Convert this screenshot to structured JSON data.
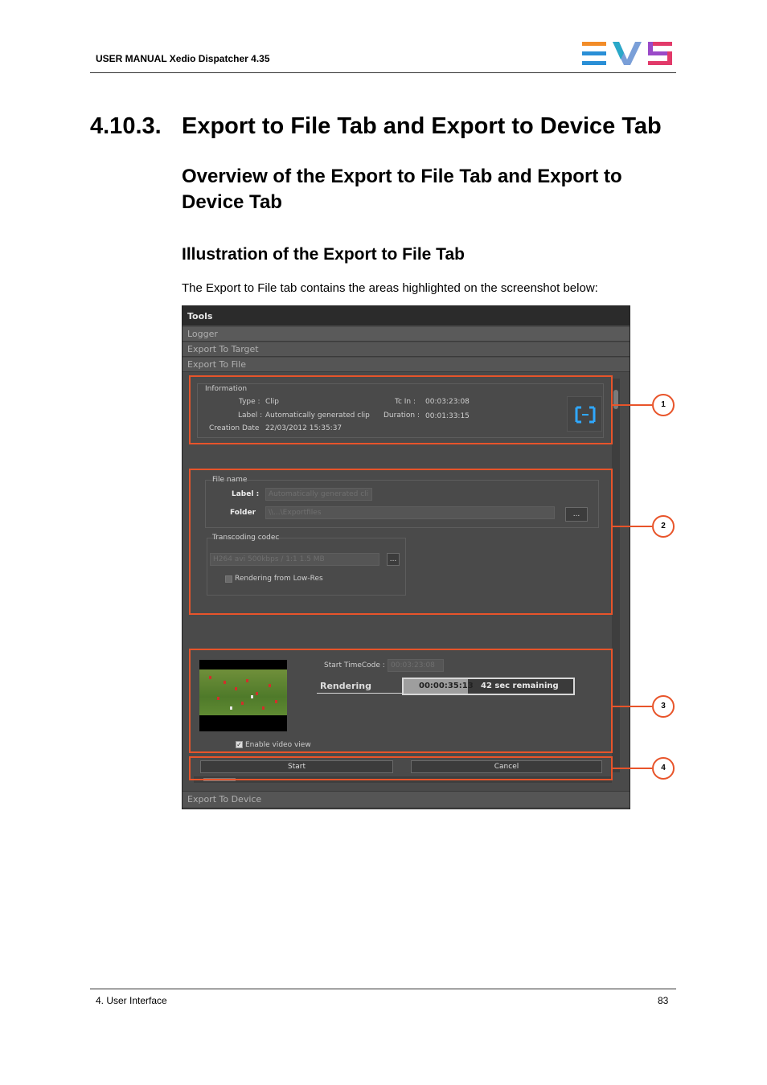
{
  "header": {
    "title": "USER MANUAL  Xedio Dispatcher 4.35"
  },
  "logo": {
    "name": "evs-logo",
    "colors": [
      "#f28c28",
      "#2a8fd6",
      "#7a57c8",
      "#e23a6a"
    ]
  },
  "section": {
    "number": "4.10.3.",
    "title": "Export to File Tab and Export to Device Tab",
    "subtitle": "Overview of the Export to File Tab and Export to Device Tab",
    "subsubtitle": "Illustration of the Export to File Tab",
    "intro": "The Export to File tab contains the areas highlighted on the screenshot below:"
  },
  "screenshot": {
    "tools": "Tools",
    "logger": "Logger",
    "export_target": "Export To Target",
    "export_file": "Export To File",
    "export_device": "Export To Device",
    "information": {
      "group": "Information",
      "type_label": "Type :",
      "type_value": "Clip",
      "label_label": "Label :",
      "label_value": "Automatically generated clip",
      "creation_label": "Creation Date",
      "creation_value": "22/03/2012 15:35:37",
      "tcin_label": "Tc In :",
      "tcin_value": "00:03:23:08",
      "duration_label": "Duration :",
      "duration_value": "00:01:33:15"
    },
    "filename": {
      "group": "File name",
      "label_label": "Label :",
      "label_value": "Automatically generated cli",
      "folder_label": "Folder",
      "folder_value": "\\\\...\\Exportfiles",
      "browse": "...",
      "codec_group": "Transcoding codec",
      "codec_value": "H264 avi 500kbps / 1:1 1.5 MB",
      "codec_browse": "...",
      "lowres": "Rendering from Low-Res"
    },
    "render": {
      "start_tc_label": "Start TimeCode :",
      "start_tc_value": "00:03:23:08",
      "rendering": "Rendering",
      "progress_time": "00:00:35:13",
      "remaining": "42 sec remaining",
      "progress_fraction": 0.38,
      "enable_video": "Enable video view"
    },
    "buttons": {
      "start": "Start",
      "cancel": "Cancel"
    }
  },
  "callouts": [
    "1",
    "2",
    "3",
    "4"
  ],
  "footer": {
    "left": "4. User Interface",
    "right": "83"
  },
  "colors": {
    "highlight": "#e8542a",
    "panel": "#4a4a4a"
  }
}
